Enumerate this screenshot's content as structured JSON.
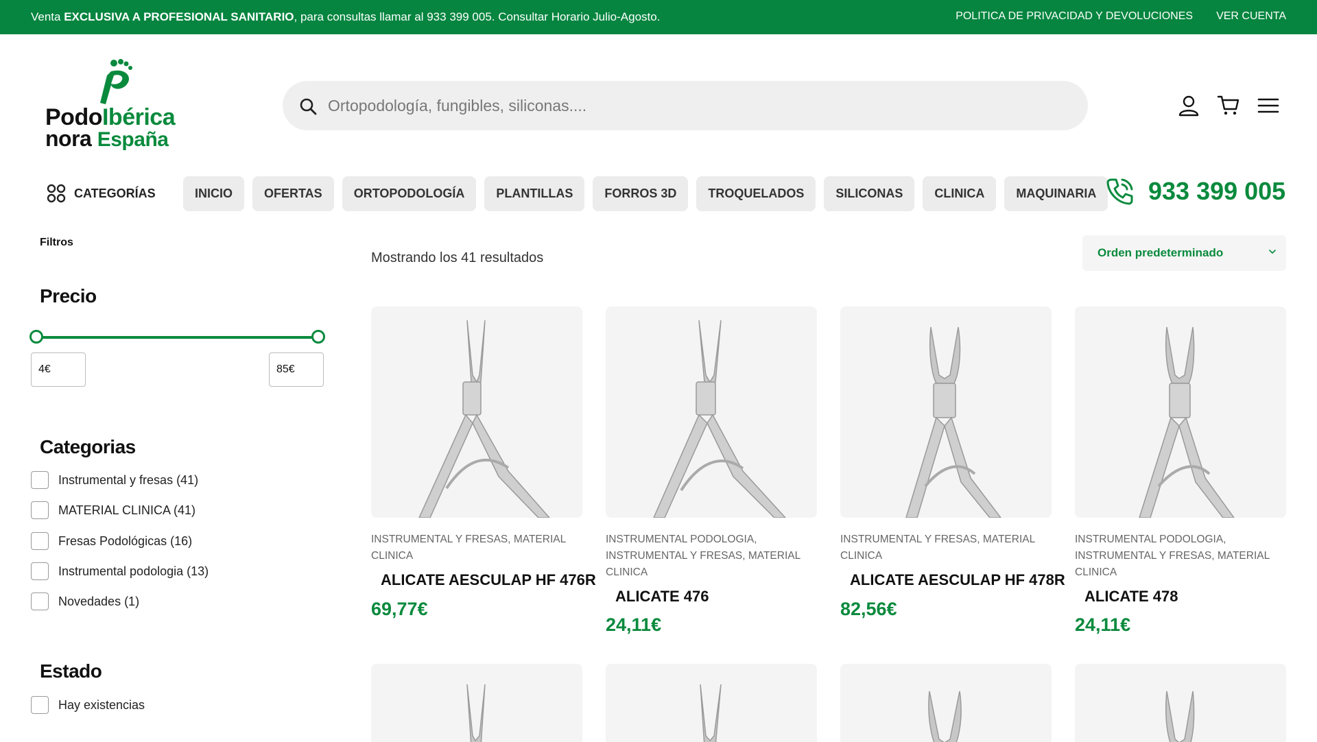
{
  "topbar": {
    "msg_pre": "Venta ",
    "msg_bold": "EXCLUSIVA A PROFESIONAL SANITARIO",
    "msg_post": ", para consultas llamar al 933 399 005. Consultar Horario Julio-Agosto.",
    "privacy_link": "POLITICA DE PRIVACIDAD Y DEVOLUCIONES",
    "account_link": "VER CUENTA"
  },
  "logo": {
    "line1a": "Podo",
    "line1b": "Ibérica",
    "line2a": "nora",
    "line2b": "España"
  },
  "search": {
    "placeholder": "Ortopodología, fungibles, siliconas...."
  },
  "nav": {
    "categories_label": "CATEGORÍAS",
    "items": [
      "INICIO",
      "OFERTAS",
      "ORTOPODOLOGÍA",
      "PLANTILLAS",
      "FORROS 3D",
      "TROQUELADOS",
      "SILICONAS",
      "CLINICA",
      "MAQUINARIA"
    ],
    "phone": "933 399 005"
  },
  "sidebar": {
    "filters_label": "Filtros",
    "price_title": "Precio",
    "price_min": "4€",
    "price_max": "85€",
    "categories_title": "Categorias",
    "categories": [
      "Instrumental y fresas (41)",
      "MATERIAL CLINICA (41)",
      "Fresas Podológicas (16)",
      "Instrumental podologia (13)",
      "Novedades (1)"
    ],
    "state_title": "Estado",
    "state_options": [
      "Hay existencias"
    ]
  },
  "results": {
    "count_text": "Mostrando los 41 resultados",
    "sort_label": "Orden predeterminado"
  },
  "products": [
    {
      "category": "INSTRUMENTAL Y FRESAS, MATERIAL CLINICA",
      "name": "ALICATE AESCULAP HF 476R",
      "price": "69,77€"
    },
    {
      "category": "INSTRUMENTAL PODOLOGIA, INSTRUMENTAL Y FRESAS, MATERIAL CLINICA",
      "name": "ALICATE 476",
      "price": "24,11€"
    },
    {
      "category": "INSTRUMENTAL Y FRESAS, MATERIAL CLINICA",
      "name": "ALICATE AESCULAP HF 478R",
      "price": "82,56€"
    },
    {
      "category": "INSTRUMENTAL PODOLOGIA, INSTRUMENTAL Y FRESAS, MATERIAL CLINICA",
      "name": "ALICATE 478",
      "price": "24,11€"
    }
  ],
  "colors": {
    "brand_green": "#05853f",
    "price_green": "#0a8a3d"
  }
}
